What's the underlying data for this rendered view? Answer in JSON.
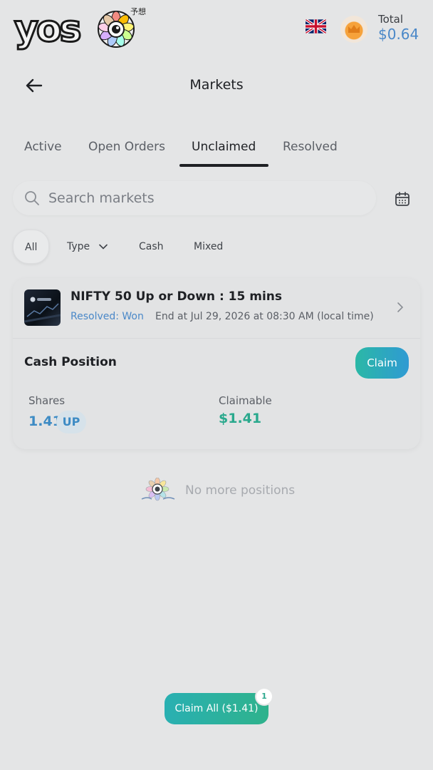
{
  "header": {
    "logo_text": "yos",
    "logo_kanji": "予想",
    "language_icon": "uk-flag-icon",
    "coin_icon": "crown-coin-icon",
    "total_label": "Total",
    "total_value": "$0.64"
  },
  "topbar": {
    "back_icon": "arrow-left-icon",
    "title": "Markets"
  },
  "tabs": [
    {
      "label": "Active"
    },
    {
      "label": "Open Orders"
    },
    {
      "label": "Unclaimed"
    },
    {
      "label": "Resolved"
    }
  ],
  "active_tab": "Unclaimed",
  "search": {
    "placeholder": "Search markets",
    "icon": "search-icon",
    "calendar_icon": "calendar-icon"
  },
  "filters": [
    {
      "label": "All"
    },
    {
      "label": "Type"
    },
    {
      "label": "Cash"
    },
    {
      "label": "Mixed"
    }
  ],
  "active_filter": "All",
  "position_card": {
    "market_title": "NIFTY 50 Up or Down : 15 mins",
    "status": "Resolved: Won",
    "end_text": "End at Jul 29, 2026 at 08:30 AM (local time)",
    "position_title": "Cash Position",
    "claim_label": "Claim",
    "shares_label": "Shares",
    "shares_value": "1.41",
    "outcome_badge": "UP",
    "claimable_label": "Claimable",
    "claimable_value": "$1.41"
  },
  "empty_state": {
    "text": "No more positions",
    "icon": "mascot-icon"
  },
  "footer": {
    "claim_all_label": "Claim All ($1.41)",
    "claim_all_count": "1"
  },
  "colors": {
    "accent_blue": "#4a88c8",
    "accent_green": "#2aa98d",
    "background": "#e4e5e6"
  }
}
